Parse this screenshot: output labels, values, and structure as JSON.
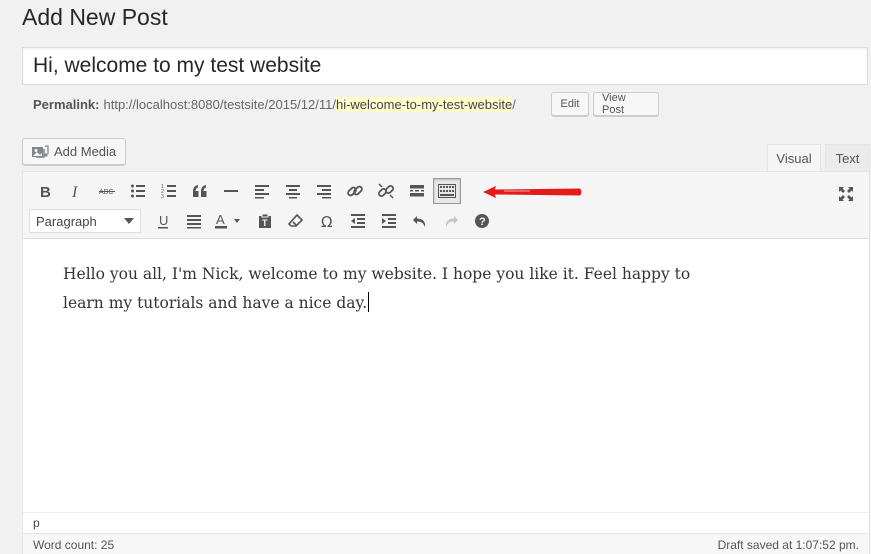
{
  "page": {
    "title": "Add New Post"
  },
  "post": {
    "title_value": "Hi, welcome to my test website",
    "permalink_label": "Permalink:",
    "permalink_base": "http://localhost:8080/testsite/2015/12/11/",
    "permalink_slug": "hi-welcome-to-my-test-website",
    "permalink_trailing": "/",
    "edit_label": "Edit",
    "view_post_label": "View Post"
  },
  "media": {
    "add_media_label": "Add Media"
  },
  "tabs": {
    "visual": "Visual",
    "text": "Text"
  },
  "toolbar": {
    "row1": [
      "bold-icon",
      "italic-icon",
      "strikethrough-icon",
      "bulleted-list-icon",
      "numbered-list-icon",
      "blockquote-icon",
      "horizontal-line-icon",
      "align-left-icon",
      "align-center-icon",
      "align-right-icon",
      "insert-link-icon",
      "remove-link-icon",
      "read-more-icon",
      "toolbar-toggle-icon"
    ],
    "row2": [
      "underline-icon",
      "justify-icon",
      "text-color-icon",
      "paste-as-text-icon",
      "clear-formatting-icon",
      "special-character-icon",
      "outdent-icon",
      "indent-icon",
      "undo-icon",
      "redo-icon",
      "help-icon"
    ],
    "format_select_value": "Paragraph",
    "fullscreen_icon": "fullscreen-icon"
  },
  "editor": {
    "line1": "Hello you all, I'm Nick, welcome to my website. I hope you like it. Feel happy to",
    "line2": "learn my tutorials and have a nice day.",
    "path": "p",
    "word_count": "Word count: 25",
    "draft_status": "Draft saved at 1:07:52 pm."
  },
  "colors": {
    "annotation_arrow": "#e31b1b",
    "permalink_highlight": "#fffbcc"
  }
}
